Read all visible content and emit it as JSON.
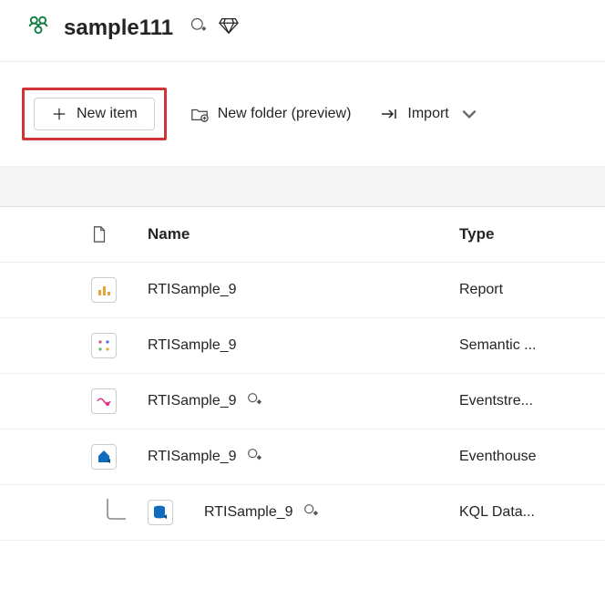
{
  "header": {
    "title": "sample111"
  },
  "toolbar": {
    "new_item_label": "New item",
    "new_folder_label": "New folder (preview)",
    "import_label": "Import"
  },
  "table": {
    "columns": {
      "name": "Name",
      "type": "Type"
    },
    "rows": [
      {
        "name": "RTISample_9",
        "type": "Report",
        "icon": "report",
        "has_badge": false,
        "child": false
      },
      {
        "name": "RTISample_9",
        "type": "Semantic ...",
        "icon": "semantic",
        "has_badge": false,
        "child": false
      },
      {
        "name": "RTISample_9",
        "type": "Eventstre...",
        "icon": "eventstream",
        "has_badge": true,
        "child": false
      },
      {
        "name": "RTISample_9",
        "type": "Eventhouse",
        "icon": "eventhouse",
        "has_badge": true,
        "child": false
      },
      {
        "name": "RTISample_9",
        "type": "KQL Data...",
        "icon": "kqldb",
        "has_badge": true,
        "child": true
      }
    ]
  }
}
